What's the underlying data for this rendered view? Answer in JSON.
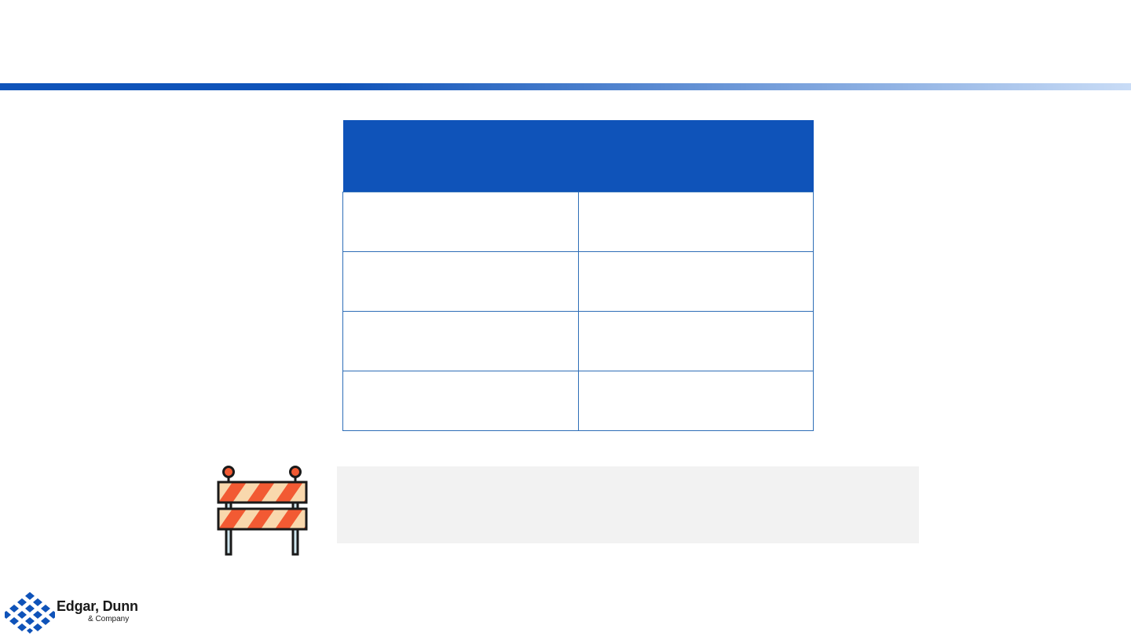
{
  "theme": {
    "brand_blue": "#0f53b9",
    "gradient_start": "#0f53b9",
    "gradient_end": "#c9dcf6",
    "cell_border": "#2e6eb7",
    "note_background": "#f2f2f2",
    "barricade_stripe": "#f25a33",
    "barricade_fill": "#f9d8ad",
    "barricade_outline": "#1a1a1a"
  },
  "table": {
    "headers": [
      "",
      ""
    ],
    "rows": [
      [
        "",
        ""
      ],
      [
        "",
        ""
      ],
      [
        "",
        ""
      ],
      [
        "",
        ""
      ]
    ]
  },
  "note": {
    "text": ""
  },
  "icons": {
    "barricade": "road-barricade-icon",
    "logo_mark": "diamond-grid-logo-icon"
  },
  "logo": {
    "name": "Edgar, Dunn",
    "subtitle": "& Company"
  }
}
